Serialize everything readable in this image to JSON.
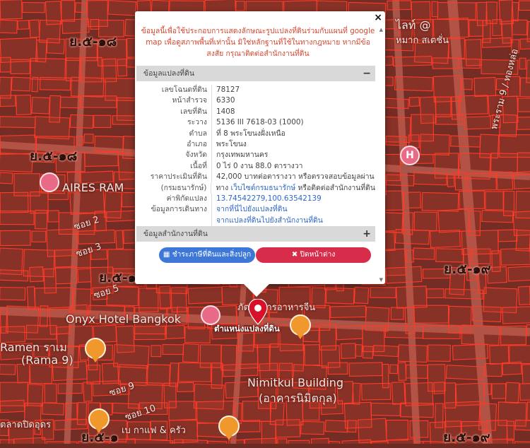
{
  "popup": {
    "close_label": "×",
    "notice": "ข้อมูลนี้เพื่อใช้ประกอบการแสดงลักษณะรูปแปลงที่ดินร่วมกับแผนที่ google map เพื่อดูสภาพพื้นที่เท่านั้น มิใช่หลักฐานที่ใช้ในทางกฎหมาย หากมีข้อสงสัย กรุณาติดต่อสำนักงานที่ดิน",
    "section1": {
      "title": "ข้อมูลแปลงที่ดิน",
      "toggle": "−"
    },
    "rows": [
      {
        "k": "เลขโฉนดที่ดิน",
        "v": "78127"
      },
      {
        "k": "หน้าสำรวจ",
        "v": "6330"
      },
      {
        "k": "เลขที่ดิน",
        "v": "1408"
      },
      {
        "k": "ระวาง",
        "v": "5136 III 7618-03 (1000)"
      },
      {
        "k": "ตำบล",
        "v": "ที่ 8 พระโขนงฝั่งเหนือ"
      },
      {
        "k": "อำเภอ",
        "v": "พระโขนง"
      },
      {
        "k": "จังหวัด",
        "v": "กรุงเทพมหานคร"
      },
      {
        "k": "เนื้อที่",
        "v": "0 ไร่ 0 งาน 88.0 ตารางวา"
      },
      {
        "k": "ราคาประเมินที่ดิน",
        "v": "42,000 บาทต่อตารางวา หรือตรวจสอบข้อมูลผ่าน"
      }
    ],
    "row_dept_key": "(กรมธนารักษ์)",
    "row_dept_pre": "ทาง ",
    "row_dept_link": "เว็บไซต์กรมธนารักษ์",
    "row_dept_post": " หรือติดต่อสำนักงานที่ดิน",
    "row_coord_key": "ค่าพิกัดแปลง",
    "row_coord_val": "13.74542279,100.63542139",
    "row_nav_key": "ข้อมูลการเดินทาง",
    "row_nav_1": "จากที่นี่ไปยังแปลงที่ดิน",
    "row_nav_2": "จากแปลงที่ดินไปยังสำนักงานที่ดิน",
    "section2": {
      "title": "ข้อมูลสำนักงานที่ดิน",
      "toggle": "+"
    },
    "btn_tax": "ชำระภาษีที่ดินและสิ่งปลูกสร้าง",
    "btn_close": "ปิดหน้าต่าง"
  },
  "map": {
    "labels": {
      "road_top_left": "ย.๕-๑๘",
      "road_mid_left": "ย.๕-๑๘",
      "road_center": "ย.๕-๑",
      "road_right": "ย.๕-๑๙",
      "road_bottom_left": "ย.๕-๑",
      "road_bottom_right": "ย.๕-๑๙",
      "aires": "AIRES RAM",
      "onyx": "Onyx Hotel Bangkok",
      "ramen1": "Ramen ราเม",
      "ramen2": "(Rama 9)",
      "nimitkul1": "Nimitkul Building",
      "nimitkul2": "(อาคารนิมิตกุล)",
      "soi2": "ซอย 2",
      "soi3": "ซอย 3",
      "soi5": "ซอย 5",
      "soi9": "ซอย 9",
      "soi10": "ซอย 10",
      "top_right1": "ไลท์ @",
      "top_right2": "หมาก สเตชั่น",
      "bottom_left": "ตลาดปิดอุดร",
      "bottom_center": "เบ กาแฟ & ครัว",
      "right_vertical": "พระราม 9 / ทองหล่อ",
      "hotel_h": "H",
      "pin_label": "ตำแหน่งแปลงที่ดิน",
      "food_label": "ภัตตาคารอาหารจีน"
    },
    "colors": {
      "parcel_line": "#ff3b2a",
      "base": "#6b2a22",
      "pin": "#d8102a"
    }
  }
}
